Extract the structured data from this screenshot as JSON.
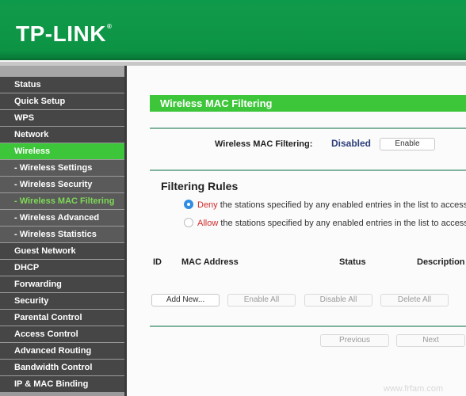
{
  "header": {
    "logo": "TP-LINK",
    "registered_mark": "®"
  },
  "sidebar": {
    "items": [
      {
        "label": "Status",
        "type": "main",
        "state": "normal"
      },
      {
        "label": "Quick Setup",
        "type": "main",
        "state": "normal"
      },
      {
        "label": "WPS",
        "type": "main",
        "state": "normal"
      },
      {
        "label": "Network",
        "type": "main",
        "state": "normal"
      },
      {
        "label": "Wireless",
        "type": "main",
        "state": "active"
      },
      {
        "label": "- Wireless Settings",
        "type": "sub",
        "state": "normal"
      },
      {
        "label": "- Wireless Security",
        "type": "sub",
        "state": "normal"
      },
      {
        "label": "- Wireless MAC Filtering",
        "type": "sub",
        "state": "active"
      },
      {
        "label": "- Wireless Advanced",
        "type": "sub",
        "state": "normal"
      },
      {
        "label": "- Wireless Statistics",
        "type": "sub",
        "state": "normal"
      },
      {
        "label": "Guest Network",
        "type": "main",
        "state": "normal"
      },
      {
        "label": "DHCP",
        "type": "main",
        "state": "normal"
      },
      {
        "label": "Forwarding",
        "type": "main",
        "state": "normal"
      },
      {
        "label": "Security",
        "type": "main",
        "state": "normal"
      },
      {
        "label": "Parental Control",
        "type": "main",
        "state": "normal"
      },
      {
        "label": "Access Control",
        "type": "main",
        "state": "normal"
      },
      {
        "label": "Advanced Routing",
        "type": "main",
        "state": "normal"
      },
      {
        "label": "Bandwidth Control",
        "type": "main",
        "state": "normal"
      },
      {
        "label": "IP & MAC Binding",
        "type": "main",
        "state": "normal"
      }
    ]
  },
  "main": {
    "title": "Wireless MAC Filtering",
    "status": {
      "label": "Wireless MAC Filtering:",
      "value": "Disabled",
      "button": "Enable"
    },
    "filtering_rules": {
      "title": "Filtering Rules",
      "options": [
        {
          "keyword": "Deny",
          "text": " the stations specified by any enabled entries in the list to access.",
          "checked": true
        },
        {
          "keyword": "Allow",
          "text": " the stations specified by any enabled entries in the list to access.",
          "checked": false
        }
      ]
    },
    "table": {
      "columns": [
        "ID",
        "MAC Address",
        "Status",
        "Description"
      ],
      "rows": []
    },
    "actions": {
      "add_new": "Add New...",
      "enable_all": "Enable All",
      "disable_all": "Disable All",
      "delete_all": "Delete All"
    },
    "pagination": {
      "previous": "Previous",
      "next": "Next"
    }
  },
  "watermark": "www.frfam.com",
  "colors": {
    "brand_green": "#0c9444",
    "accent_green": "#3ec63a",
    "active_sub_text": "#7ed957",
    "status_value": "#2d3e7a",
    "keyword_red": "#d12b2b",
    "radio_blue": "#2f8de4"
  }
}
